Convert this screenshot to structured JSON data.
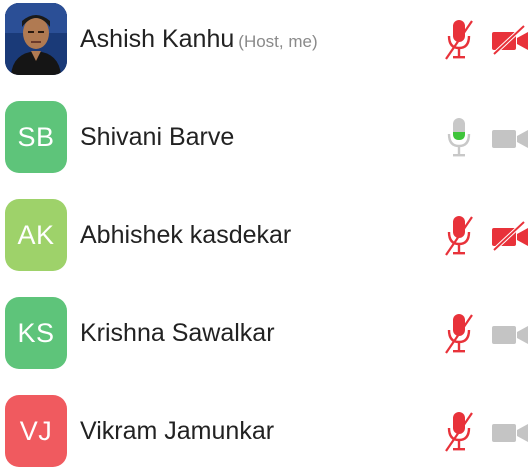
{
  "participants": [
    {
      "initials": "",
      "avatar_type": "photo",
      "avatar_color": "#1c2f63",
      "name": "Ashish Kanhu",
      "tag": "(Host, me)",
      "mic": "muted",
      "cam": "off"
    },
    {
      "initials": "SB",
      "avatar_type": "initials",
      "avatar_color": "#5ec47a",
      "name": "Shivani Barve",
      "tag": "",
      "mic": "active",
      "cam": "on"
    },
    {
      "initials": "AK",
      "avatar_type": "initials",
      "avatar_color": "#9ed26a",
      "name": "Abhishek kasdekar",
      "tag": "",
      "mic": "muted",
      "cam": "off"
    },
    {
      "initials": "KS",
      "avatar_type": "initials",
      "avatar_color": "#5ec47a",
      "name": "Krishna Sawalkar",
      "tag": "",
      "mic": "muted",
      "cam": "on"
    },
    {
      "initials": "VJ",
      "avatar_type": "initials",
      "avatar_color": "#f05a5f",
      "name": "Vikram Jamunkar",
      "tag": "",
      "mic": "muted",
      "cam": "on"
    }
  ],
  "colors": {
    "muted_red": "#e8323a",
    "mic_gray": "#c8c8c8",
    "mic_green": "#3ec43a",
    "cam_gray": "#c4c4c4"
  }
}
